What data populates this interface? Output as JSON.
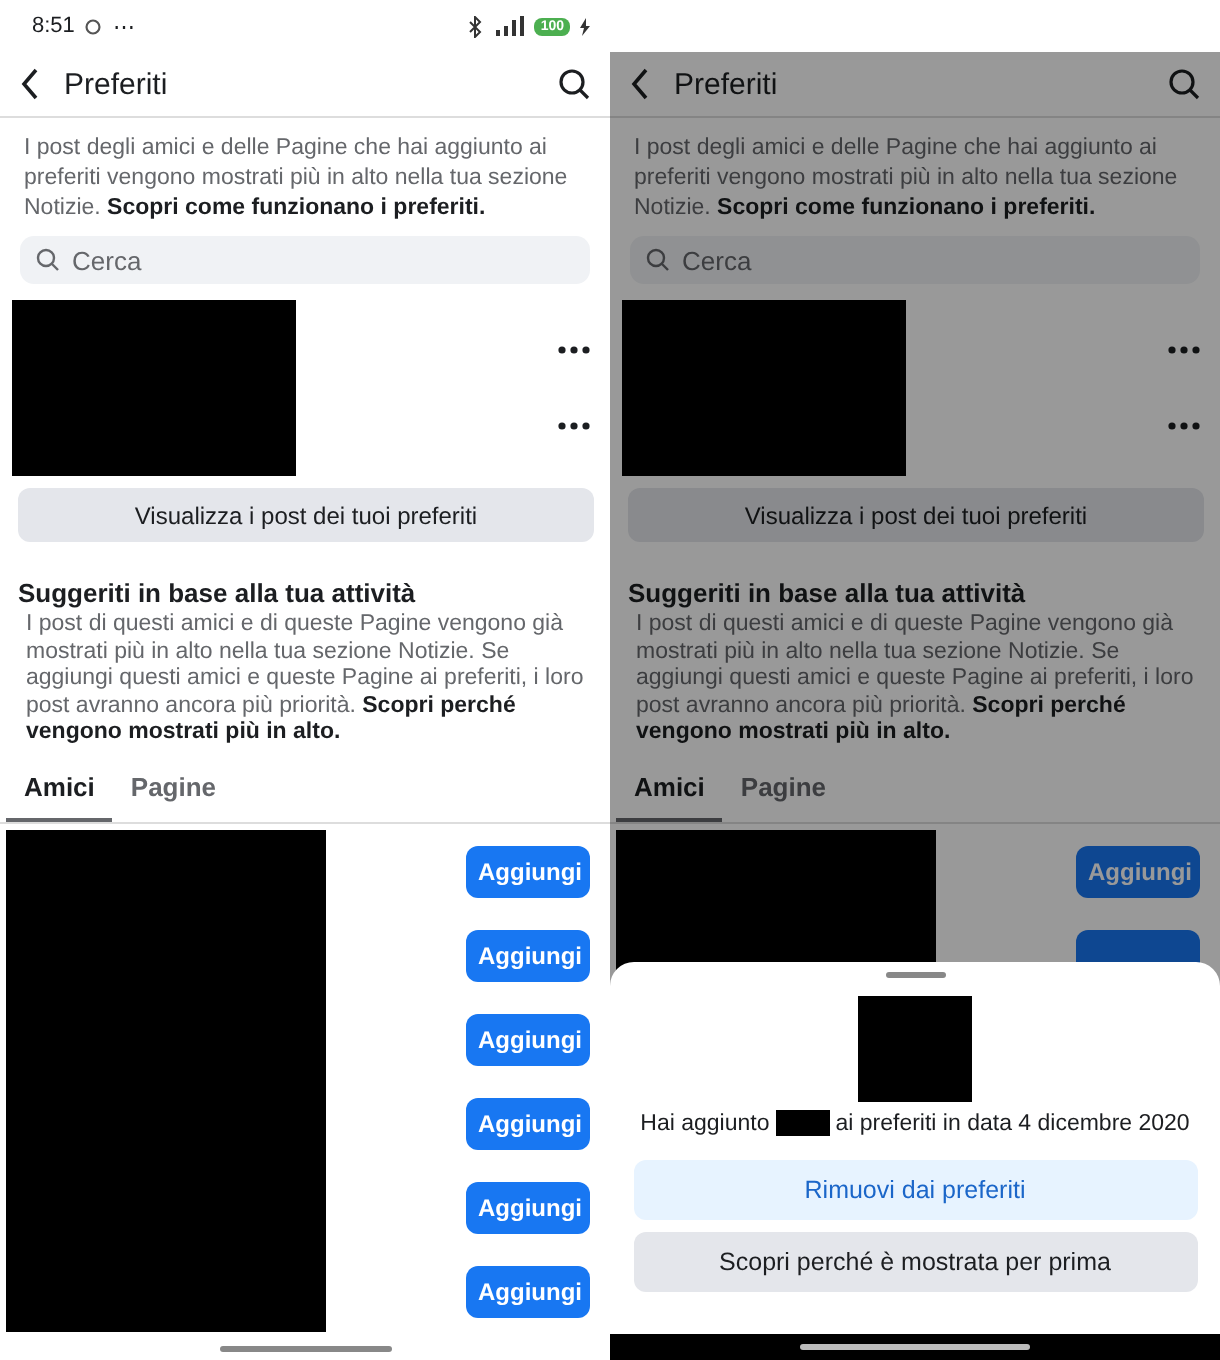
{
  "screens": [
    {
      "dimmed": false,
      "status_bar": {
        "time": "8:51",
        "more": "⋯",
        "battery": "100"
      },
      "header": {
        "title": "Preferiti"
      },
      "intro": {
        "text": "I post degli amici e delle Pagine che hai aggiunto ai preferiti vengono mostrati più in alto nella tua sezione Notizie. ",
        "link": "Scopri come funzionano i preferiti."
      },
      "search": {
        "placeholder": "Cerca"
      },
      "view_button": "Visualizza i post dei tuoi preferiti",
      "suggestions": {
        "title": "Suggeriti in base alla tua attività",
        "text": "I post di questi amici e di queste Pagine vengono già mostrati più in alto nella tua sezione Notizie. Se aggiungi questi amici e queste Pagine ai preferiti, i loro post avranno ancora più priorità. **Scopri perché vengono mostrati più in alto.**"
      },
      "tabs": [
        {
          "label": "Amici",
          "selected": true
        },
        {
          "label": "Pagine",
          "selected": false
        }
      ],
      "add_buttons": [
        "Aggiungi",
        "Aggiungi",
        "Aggiungi",
        "Aggiungi",
        "Aggiungi",
        "Aggiungi"
      ]
    },
    {
      "dimmed": true,
      "header": {
        "title": "Preferiti"
      },
      "intro": {
        "text": "I post degli amici e delle Pagine che hai aggiunto ai preferiti vengono mostrati più in alto nella tua sezione Notizie. ",
        "link": "Scopri come funzionano i preferiti."
      },
      "search": {
        "placeholder": "Cerca"
      },
      "view_button": "Visualizza i post dei tuoi preferiti",
      "suggestions": {
        "title": "Suggeriti in base alla tua attività",
        "text": "I post di questi amici e di queste Pagine vengono già mostrati più in alto nella tua sezione Notizie. Se aggiungi questi amici e queste Pagine ai preferiti, i loro post avranno ancora più priorità. **Scopri perché vengono mostrati più in alto.**"
      },
      "tabs": [
        {
          "label": "Amici",
          "selected": true
        },
        {
          "label": "Pagine",
          "selected": false
        }
      ],
      "add_buttons": [
        "Aggiungi"
      ],
      "covered_button": true,
      "sheet": {
        "text_before": "Hai aggiunto",
        "text_after": "ai preferiti in data 4 dicembre 2020",
        "remove_button": "Rimuovi dai preferiti",
        "why_button": "Scopri perché è mostrata per prima"
      }
    }
  ]
}
